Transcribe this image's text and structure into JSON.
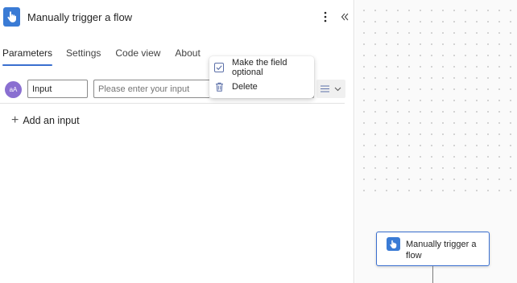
{
  "panel": {
    "title": "Manually trigger a flow",
    "tabs": [
      {
        "label": "Parameters",
        "active": true
      },
      {
        "label": "Settings",
        "active": false
      },
      {
        "label": "Code view",
        "active": false
      },
      {
        "label": "About",
        "active": false
      }
    ],
    "input_row": {
      "avatar_text": "aA",
      "name_value": "Input",
      "description_placeholder": "Please enter your input"
    },
    "add_input_label": "Add an input"
  },
  "context_menu": {
    "items": [
      {
        "label": "Make the field optional",
        "icon": "checkbox-icon"
      },
      {
        "label": "Delete",
        "icon": "trash-icon"
      }
    ]
  },
  "canvas": {
    "card_title": "Manually trigger a flow"
  },
  "colors": {
    "accent": "#3a6fcf",
    "trigger_icon": "#3a7bd5",
    "avatar": "#8a6fd1"
  }
}
